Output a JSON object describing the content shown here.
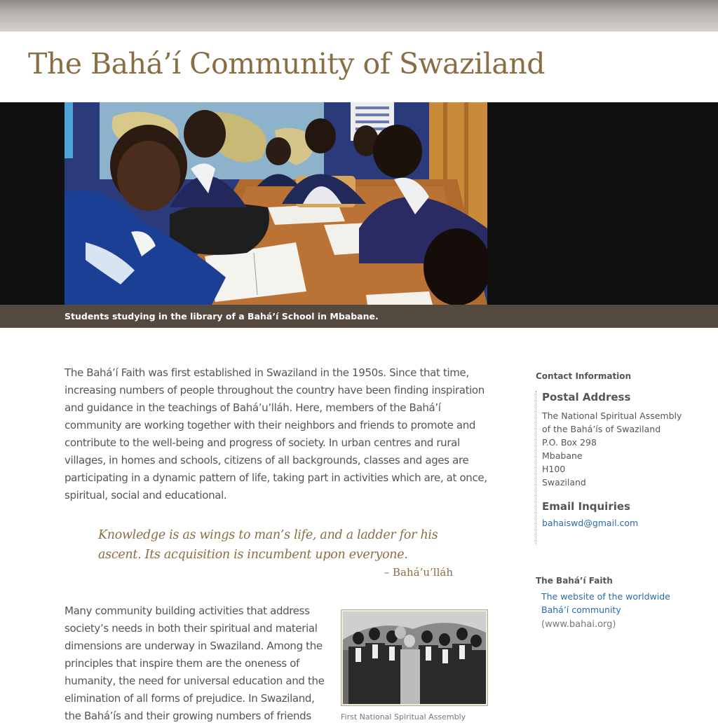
{
  "header": {
    "site_title": "The Bahá’í Community of Swaziland"
  },
  "hero": {
    "caption": "Students studying in the library of a Bahá’í School in Mbabane."
  },
  "main": {
    "intro": "The Bahá’í Faith was first established in Swaziland in the 1950s. Since that time, increasing numbers of people throughout the country have been finding inspiration and guidance in the teachings of Bahá’u’lláh. Here, members of the Bahá’í community are working together with their neighbors and friends to promote and contribute to the well-being and progress of society. In urban centres and rural villages, in homes and schools, citizens of all backgrounds, classes and ages are participating in a dynamic pattern of life, taking part in activities which are, at once, spiritual, social and educational.",
    "quote": "Knowledge is as wings to man’s life, and a ladder for his ascent. Its acquisition is incumbent upon everyone.",
    "quote_author": "– Bahá’u’lláh",
    "body2": "Many community building activities that address society’s needs in both their spiritual and material dimensions are underway in Swaziland. Among the principles that inspire them are the oneness of humanity, the need for universal education and the elimination of all forms of prejudice. In Swaziland, the Bahá’ís and their growing numbers of friends",
    "figure_caption": "First National Spiritual Assembly"
  },
  "sidebar": {
    "contact_heading": "Contact Information",
    "postal_heading": "Postal Address",
    "postal_lines": [
      "The National Spiritual Assembly",
      "of the Bahá’ís of Swaziland",
      "P.O. Box 298",
      "Mbabane",
      "H100",
      "Swaziland"
    ],
    "email_heading": "Email Inquiries",
    "email": "bahaiswd@gmail.com",
    "faith_heading": "The Bahá’í Faith",
    "faith_link": "The website of the worldwide Bahá’í community",
    "faith_url_text": "(www.bahai.org)"
  },
  "colors": {
    "title_brown": "#8a6e43",
    "caption_bar": "#54493f",
    "link_blue": "#2a6aa8",
    "body_text": "#555555"
  }
}
